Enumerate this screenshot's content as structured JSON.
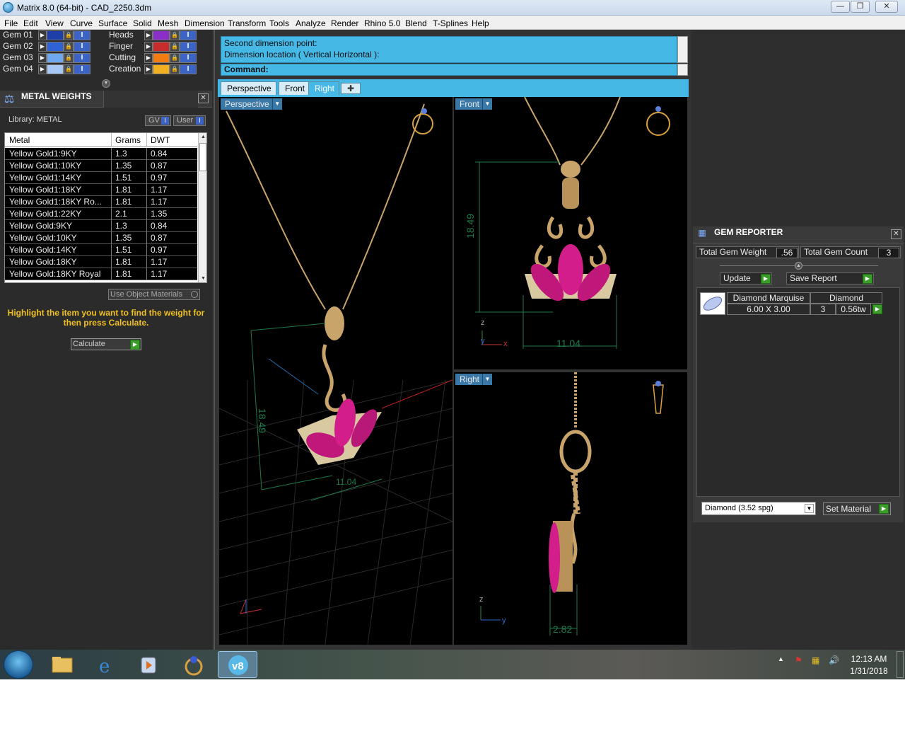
{
  "window": {
    "title": "Matrix 8.0 (64-bit) - CAD_2250.3dm",
    "min": "—",
    "max": "❐",
    "close": "✕"
  },
  "menu": [
    "File",
    "Edit",
    "View",
    "Curve",
    "Surface",
    "Solid",
    "Mesh",
    "Dimension",
    "Transform",
    "Tools",
    "Analyze",
    "Render",
    "Rhino 5.0",
    "Blend",
    "T-Splines",
    "Help"
  ],
  "layers_left": [
    {
      "name": "Gem 01",
      "color": "#1e3fa8"
    },
    {
      "name": "Gem 02",
      "color": "#2e62d6"
    },
    {
      "name": "Gem 03",
      "color": "#6ea8ee"
    },
    {
      "name": "Gem 04",
      "color": "#a7c8f4"
    }
  ],
  "layers_right": [
    {
      "name": "Heads",
      "color": "#8a2fc8"
    },
    {
      "name": "Finger",
      "color": "#c82c2c"
    },
    {
      "name": "Cutting",
      "color": "#f07c12"
    },
    {
      "name": "Creation",
      "color": "#f2b020"
    }
  ],
  "metal_weights": {
    "title": "METAL WEIGHTS",
    "library": "Library: METAL",
    "gv": "GV",
    "user": "User",
    "columns": [
      "Metal",
      "Grams",
      "DWT"
    ],
    "rows": [
      [
        "Yellow Gold1:9KY",
        "1.3",
        "0.84"
      ],
      [
        "Yellow Gold1:10KY",
        "1.35",
        "0.87"
      ],
      [
        "Yellow Gold1:14KY",
        "1.51",
        "0.97"
      ],
      [
        "Yellow Gold1:18KY",
        "1.81",
        "1.17"
      ],
      [
        "Yellow Gold1:18KY Ro...",
        "1.81",
        "1.17"
      ],
      [
        "Yellow Gold1:22KY",
        "2.1",
        "1.35"
      ],
      [
        "Yellow Gold:9KY",
        "1.3",
        "0.84"
      ],
      [
        "Yellow Gold:10KY",
        "1.35",
        "0.87"
      ],
      [
        "Yellow Gold:14KY",
        "1.51",
        "0.97"
      ],
      [
        "Yellow Gold:18KY",
        "1.81",
        "1.17"
      ],
      [
        "Yellow Gold:18KY Royal",
        "1.81",
        "1.17"
      ]
    ],
    "use_object": "Use Object Materials",
    "hint": "Highlight the item you want to find the weight for then press Calculate.",
    "calculate": "Calculate"
  },
  "command": {
    "line1": "Second dimension point:",
    "line2": "Dimension location ( Vertical  Horizontal ):",
    "prompt": "Command:"
  },
  "view_tabs": [
    "Perspective",
    "Front",
    "Right"
  ],
  "viewports": {
    "perspective": {
      "label": "Perspective",
      "dim1": "18.49",
      "dim2": "11.04"
    },
    "front": {
      "label": "Front",
      "dim_v": "18.49",
      "dim_h": "11.04",
      "axis_z": "z",
      "axis_x": "x",
      "axis_y": "y"
    },
    "right": {
      "label": "Right",
      "dim_h": "2.82",
      "axis_z": "z",
      "axis_y": "y"
    }
  },
  "gem_reporter": {
    "title": "GEM REPORTER",
    "total_weight_label": "Total Gem Weight",
    "total_weight": ".56",
    "total_count_label": "Total Gem Count",
    "total_count": "3",
    "update": "Update",
    "save_report": "Save Report",
    "gem": {
      "shape": "Diamond Marquise",
      "material": "Diamond",
      "size": "6.00 X 3.00",
      "count": "3",
      "weight": "0.56tw"
    }
  },
  "material_select": "Diamond    (3.52 spg)",
  "set_material": "Set Material",
  "clock": {
    "time": "12:13 AM",
    "date": "1/31/2018"
  }
}
